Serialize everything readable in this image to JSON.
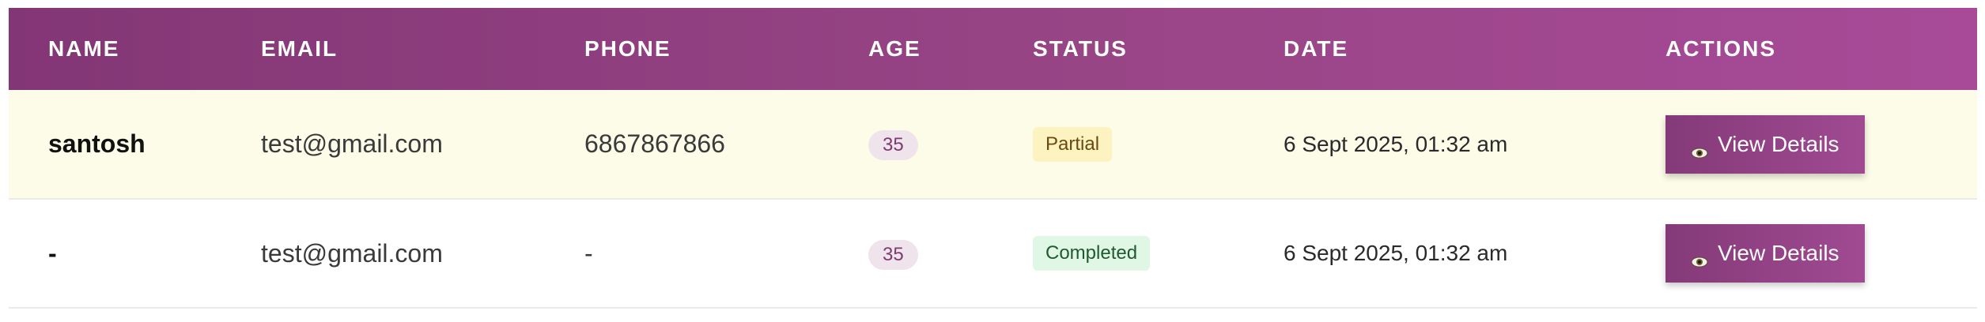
{
  "table": {
    "headers": [
      "NAME",
      "EMAIL",
      "PHONE",
      "AGE",
      "STATUS",
      "DATE",
      "ACTIONS"
    ],
    "rows": [
      {
        "name": "santosh",
        "email": "test@gmail.com",
        "phone": "6867867866",
        "age": "35",
        "status": "Partial",
        "date": "6 Sept 2025, 01:32 am",
        "action_label": "View Details"
      },
      {
        "name": "-",
        "email": "test@gmail.com",
        "phone": "-",
        "age": "35",
        "status": "Completed",
        "date": "6 Sept 2025, 01:32 am",
        "action_label": "View Details"
      }
    ]
  },
  "icons": {
    "view_icon": "eye-icon"
  },
  "colors": {
    "header_gradient_start": "#833675",
    "header_gradient_end": "#a84a98",
    "partial_row_bg": "#fdfce9",
    "partial_badge_bg": "#fdf3c0",
    "completed_badge_bg": "#e1f7e6",
    "button_bg": "#984586"
  }
}
